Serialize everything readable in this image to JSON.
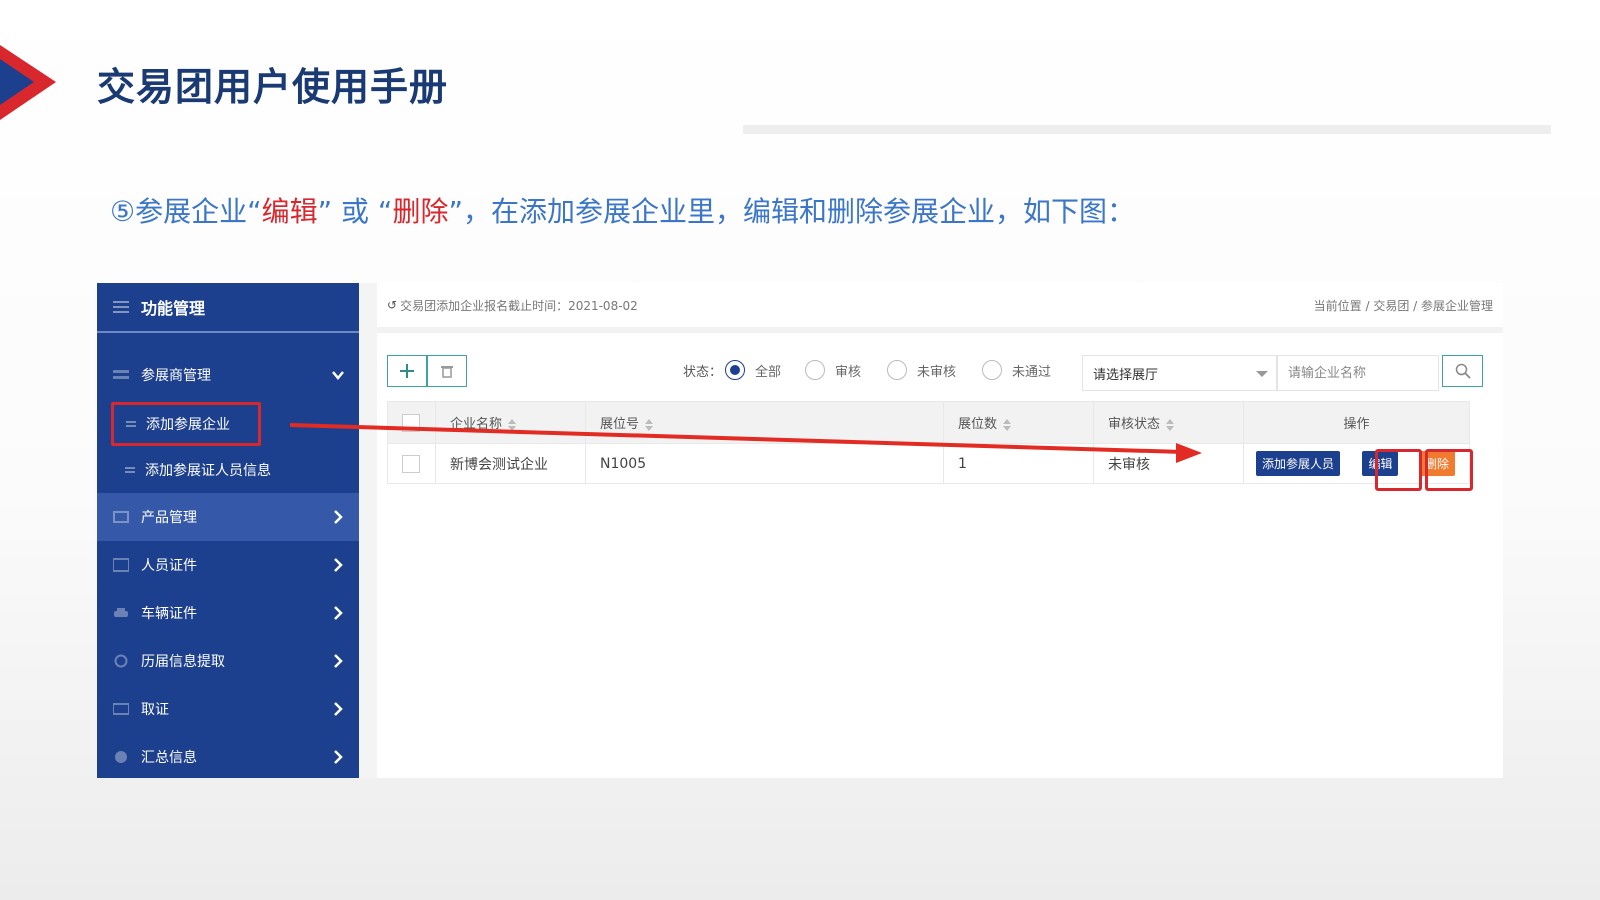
{
  "slide": {
    "title": "交易团用户使用手册",
    "instruction_prefix": "⑤参展企业“",
    "instruction_edit": "编辑",
    "instruction_mid": "” 或 “",
    "instruction_delete": "删除",
    "instruction_suffix": "”，在添加参展企业里，编辑和删除参展企业，如下图："
  },
  "colors": {
    "brand_blue": "#1c3f8e",
    "highlight_red": "#d9272e",
    "instruction_blue": "#3b76c8",
    "delete_orange": "#f07b2f",
    "teal_border": "#39a4a0"
  },
  "sidebar": {
    "header": "功能管理",
    "items": [
      {
        "label": "参展商管理",
        "icon": "list-icon",
        "expanded": true,
        "children": [
          "添加参展企业",
          "添加参展证人员信息"
        ]
      },
      {
        "label": "产品管理",
        "icon": "box-icon",
        "active": true
      },
      {
        "label": "人员证件",
        "icon": "id-card-icon"
      },
      {
        "label": "车辆证件",
        "icon": "car-icon"
      },
      {
        "label": "历届信息提取",
        "icon": "history-icon"
      },
      {
        "label": "取证",
        "icon": "card-icon"
      },
      {
        "label": "汇总信息",
        "icon": "pie-chart-icon"
      }
    ]
  },
  "topbar": {
    "deadline": "交易团添加企业报名截止时间：2021-08-02",
    "breadcrumb": "当前位置 / 交易团 / 参展企业管理"
  },
  "toolbar": {
    "status_label": "状态：",
    "radios": [
      "全部",
      "审核",
      "未审核",
      "未通过"
    ],
    "selected_radio": "全部",
    "hall_select": "请选择展厅",
    "search_placeholder": "请输企业名称"
  },
  "table": {
    "headers": [
      "企业名称",
      "展位号",
      "展位数",
      "审核状态",
      "操作"
    ],
    "rows": [
      {
        "name": "新博会测试企业",
        "booth": "N1005",
        "count": "1",
        "status": "未审核"
      }
    ],
    "actions": {
      "add_staff": "添加参展人员",
      "edit": "编辑",
      "delete": "删除"
    }
  }
}
